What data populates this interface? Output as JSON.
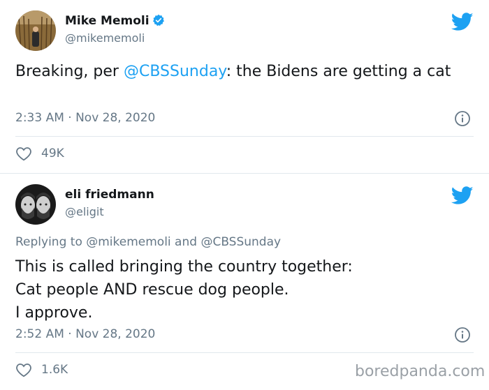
{
  "tweets": [
    {
      "author": {
        "name": "Mike Memoli",
        "handle": "@mikememoli",
        "verified": true
      },
      "text": {
        "prefix": "Breaking, per ",
        "mention": "@CBSSunday",
        "suffix": ": the Bidens are getting a cat"
      },
      "timestamp": "2:33 AM · Nov 28, 2020",
      "likes": "49K"
    },
    {
      "author": {
        "name": "eli friedmann",
        "handle": "@eligit",
        "verified": false
      },
      "reply_to": "Replying to @mikememoli and @CBSSunday",
      "lines": [
        "This is called bringing the country together:",
        "Cat people AND rescue dog people.",
        "I approve."
      ],
      "timestamp": "2:52 AM · Nov 28, 2020",
      "likes": "1.6K"
    }
  ],
  "watermark": "boredpanda.com",
  "colors": {
    "brand_blue": "#1da1f2",
    "secondary_text": "#657786",
    "divider": "#e1e8ed"
  }
}
